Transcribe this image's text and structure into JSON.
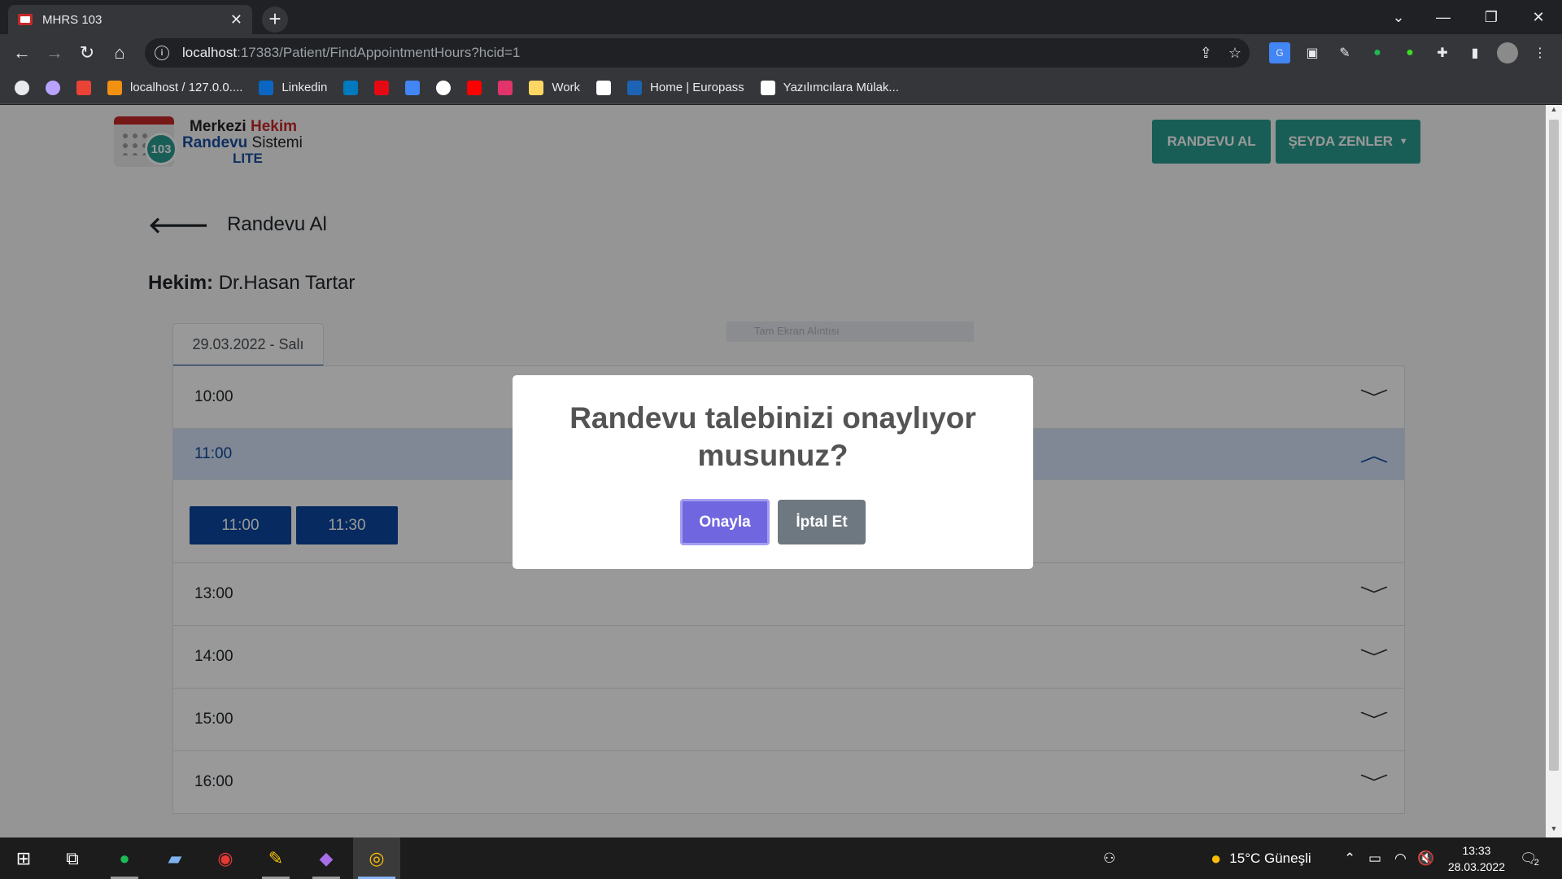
{
  "browser": {
    "tab_title": "MHRS 103",
    "new_tab_symbol": "+",
    "url_host": "localhost",
    "url_path": ":17383/Patient/FindAppointmentHours?hcid=1"
  },
  "bookmarks": [
    {
      "label": "",
      "icon": "globe-icon",
      "color": "#e8eaed"
    },
    {
      "label": "",
      "icon": "circle-icon",
      "color": "#b9a3ff"
    },
    {
      "label": "",
      "icon": "gmail-icon",
      "color": "#ea4335"
    },
    {
      "label": "localhost / 127.0.0....",
      "icon": "phpmyadmin-icon",
      "color": "#f29111"
    },
    {
      "label": "Linkedin",
      "icon": "linkedin-icon",
      "color": "#0a66c2"
    },
    {
      "label": "",
      "icon": "trello-icon",
      "color": "#0079bf"
    },
    {
      "label": "",
      "icon": "netflix-icon",
      "color": "#e50914"
    },
    {
      "label": "",
      "icon": "translate-icon",
      "color": "#4285f4"
    },
    {
      "label": "",
      "icon": "github-icon",
      "color": "#ffffff"
    },
    {
      "label": "",
      "icon": "youtube-icon",
      "color": "#ff0000"
    },
    {
      "label": "",
      "icon": "bionluk-icon",
      "color": "#e2336b"
    },
    {
      "label": "Work",
      "icon": "folder-icon",
      "color": "#fdd663"
    },
    {
      "label": "",
      "icon": "codepen-icon",
      "color": "#ffffff"
    },
    {
      "label": "Home | Europass",
      "icon": "europass-icon",
      "color": "#1d63b5"
    },
    {
      "label": "Yazılımcılara Mülak...",
      "icon": "page-icon",
      "color": "#ffffff"
    }
  ],
  "page": {
    "logo": {
      "line1_a": "Merkezi",
      "line1_b": "Hekim",
      "line2_a": "Randevu",
      "line2_b": "Sistemi",
      "line3": "LITE",
      "badge": "103"
    },
    "nav": {
      "appointment_button": "RANDEVU AL",
      "user_menu": "ŞEYDA ZENLER"
    },
    "back_label": "Randevu Al",
    "doctor_label": "Hekim:",
    "doctor_name": "Dr.Hasan Tartar",
    "date_tab": "29.03.2022 - Salı",
    "capture_hint": "Tam Ekran Alıntısı",
    "hours": [
      {
        "label": "10:00",
        "open": false
      },
      {
        "label": "11:00",
        "open": true,
        "slots": [
          "11:00",
          "11:30"
        ]
      },
      {
        "label": "13:00",
        "open": false
      },
      {
        "label": "14:00",
        "open": false
      },
      {
        "label": "15:00",
        "open": false
      },
      {
        "label": "16:00",
        "open": false
      }
    ]
  },
  "modal": {
    "message": "Randevu talebinizi onaylıyor musunuz?",
    "confirm": "Onayla",
    "cancel": "İptal Et"
  },
  "taskbar": {
    "weather": "15°C  Güneşli",
    "time": "13:33",
    "date": "28.03.2022",
    "notification_count": "2"
  },
  "colors": {
    "brand_teal": "#2a9d8f",
    "slot_blue": "#0d47a1",
    "confirm_purple": "#7066e0",
    "cancel_gray": "#6e7881"
  }
}
